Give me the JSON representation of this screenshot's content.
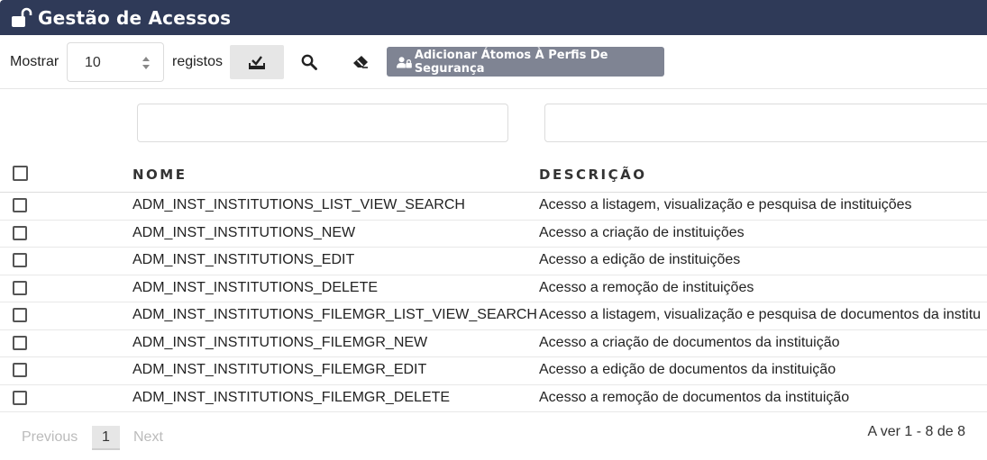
{
  "header": {
    "title": "Gestão de Acessos"
  },
  "toolbar": {
    "show_label": "Mostrar",
    "page_size": "10",
    "records_label": "registos",
    "add_button_label": "Adicionar Átomos À Perfis De Segurança"
  },
  "table": {
    "columns": {
      "name": "NOME",
      "description": "DESCRIÇÃO"
    },
    "rows": [
      {
        "name": "ADM_INST_INSTITUTIONS_LIST_VIEW_SEARCH",
        "description": "Acesso a listagem, visualização e pesquisa de instituições"
      },
      {
        "name": "ADM_INST_INSTITUTIONS_NEW",
        "description": "Acesso a criação de instituições"
      },
      {
        "name": "ADM_INST_INSTITUTIONS_EDIT",
        "description": "Acesso a edição de instituições"
      },
      {
        "name": "ADM_INST_INSTITUTIONS_DELETE",
        "description": "Acesso a remoção de instituições"
      },
      {
        "name": "ADM_INST_INSTITUTIONS_FILEMGR_LIST_VIEW_SEARCH",
        "description": "Acesso a listagem, visualização e pesquisa de documentos da institu"
      },
      {
        "name": "ADM_INST_INSTITUTIONS_FILEMGR_NEW",
        "description": "Acesso a criação de documentos da instituição"
      },
      {
        "name": "ADM_INST_INSTITUTIONS_FILEMGR_EDIT",
        "description": "Acesso a edição de documentos da instituição"
      },
      {
        "name": "ADM_INST_INSTITUTIONS_FILEMGR_DELETE",
        "description": "Acesso a remoção de documentos da instituição"
      }
    ]
  },
  "pagination": {
    "previous": "Previous",
    "current": "1",
    "next": "Next",
    "info": "A ver 1 - 8 de 8"
  },
  "icons": {
    "title": "lock-open-icon",
    "download": "download-tray-icon",
    "search": "search-icon",
    "clear": "eraser-icon",
    "add": "user-lock-icon"
  },
  "colors": {
    "header_bg": "#2f3a58",
    "button_bg": "#7f8493"
  }
}
